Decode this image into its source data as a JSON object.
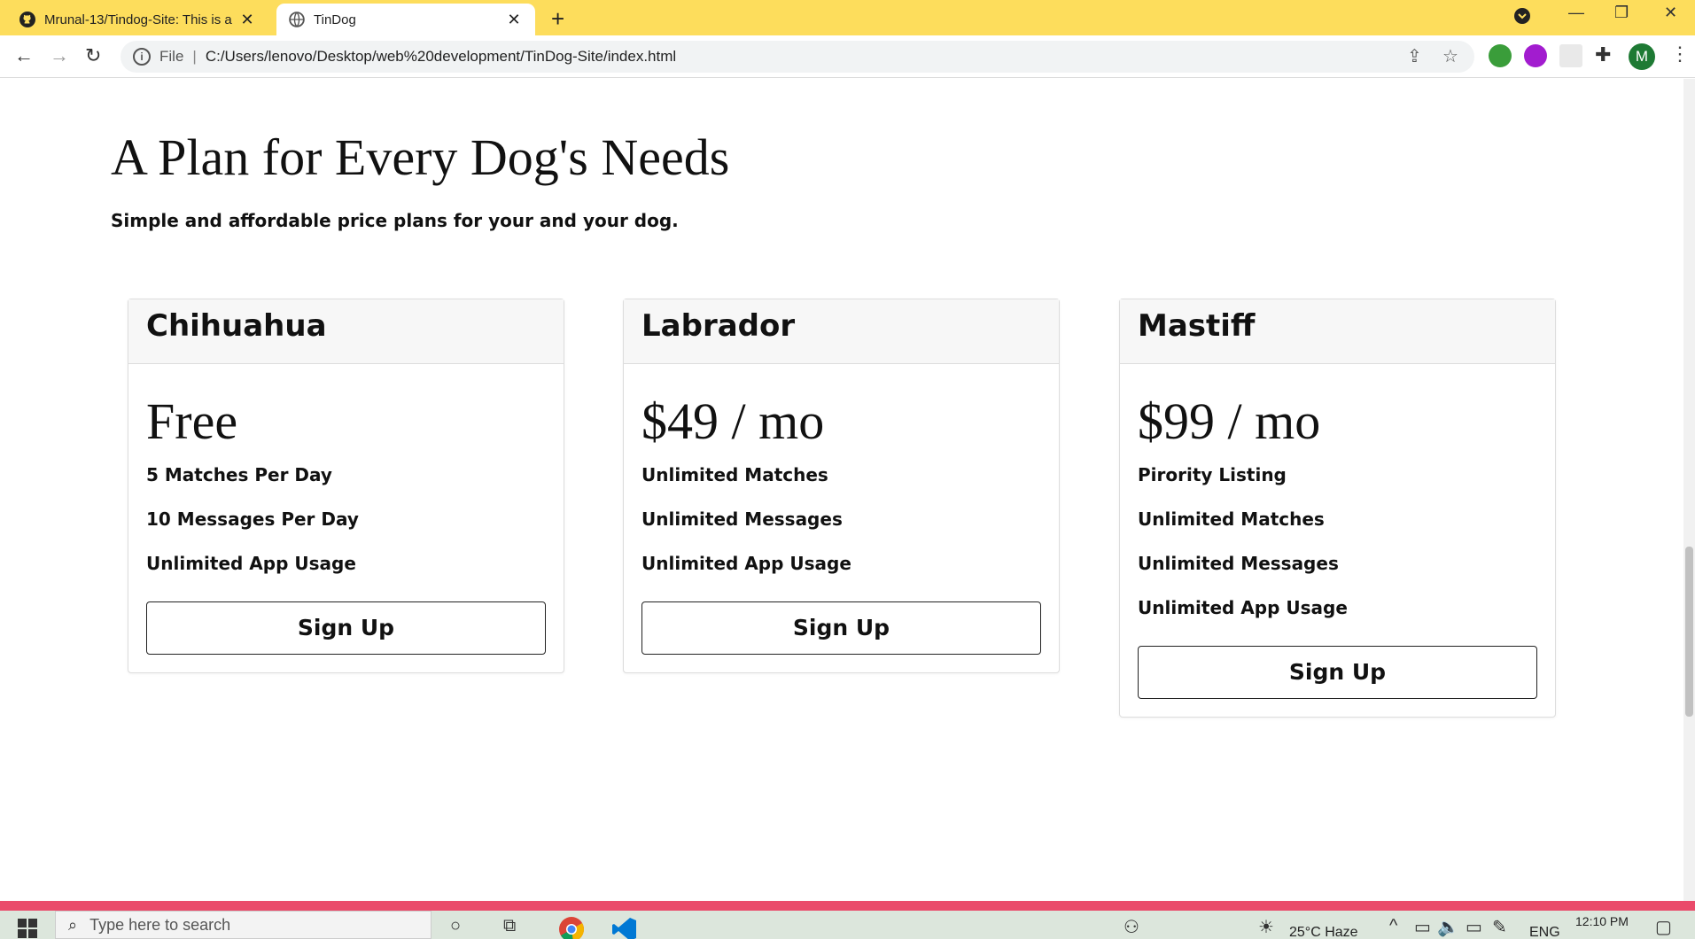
{
  "browser": {
    "tabs": [
      {
        "title": "Mrunal-13/Tindog-Site: This is a",
        "icon": "github-icon",
        "close": "✕"
      },
      {
        "title": "TinDog",
        "icon": "globe-icon",
        "close": "✕"
      }
    ],
    "new_tab": "+",
    "address": {
      "scheme_label": "File",
      "separator": "|",
      "url": "C:/Users/lenovo/Desktop/web%20development/TinDog-Site/index.html"
    },
    "profile_initial": "M"
  },
  "pricing": {
    "heading": "A Plan for Every Dog's Needs",
    "subheading": "Simple and affordable price plans for your and your dog.",
    "plans": [
      {
        "name": "Chihuahua",
        "price": "Free",
        "features": [
          "5 Matches Per Day",
          "10 Messages Per Day",
          "Unlimited App Usage"
        ],
        "button": "Sign Up"
      },
      {
        "name": "Labrador",
        "price": "$49 / mo",
        "features": [
          "Unlimited Matches",
          "Unlimited Messages",
          "Unlimited App Usage"
        ],
        "button": "Sign Up"
      },
      {
        "name": "Mastiff",
        "price": "$99 / mo",
        "features": [
          "Pirority Listing",
          "Unlimited Matches",
          "Unlimited Messages",
          "Unlimited App Usage"
        ],
        "button": "Sign Up"
      }
    ]
  },
  "taskbar": {
    "search_placeholder": "Type here to search",
    "weather": "25°C  Haze",
    "language": "ENG",
    "time": "12:10 PM"
  },
  "colors": {
    "tab_strip": "#fddd5c",
    "accent_bar": "#ea4a6a",
    "profile": "#1e7a34"
  }
}
